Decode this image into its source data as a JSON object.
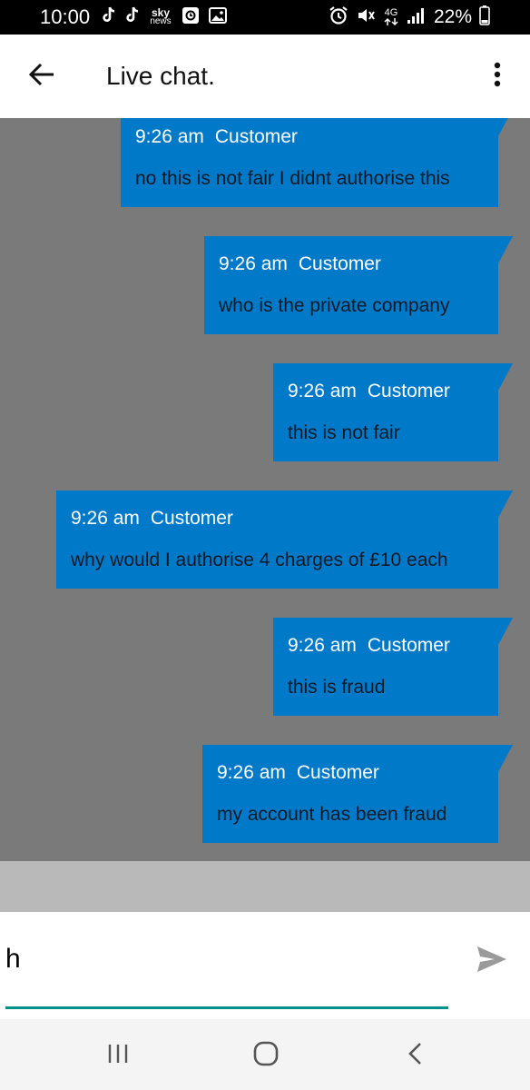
{
  "status_bar": {
    "time": "10:00",
    "news_badge_top": "sky",
    "news_badge_bottom": "news",
    "network_label": "4G",
    "battery": "22%",
    "icons": [
      "tiktok-icon",
      "tiktok-icon",
      "sky-news-icon",
      "app-icon",
      "gallery-icon",
      "alarm-icon",
      "mute-icon",
      "network-4g-icon",
      "signal-icon",
      "battery-icon"
    ]
  },
  "app_bar": {
    "title": "Live chat.",
    "icons": [
      "back-arrow-icon",
      "more-vert-icon"
    ]
  },
  "messages": [
    {
      "time": "9:26 am",
      "sender": "Customer",
      "text": "no this is not fair I didnt authorise this"
    },
    {
      "time": "9:26 am",
      "sender": "Customer",
      "text": "who is the private company"
    },
    {
      "time": "9:26 am",
      "sender": "Customer",
      "text": "this is not fair"
    },
    {
      "time": "9:26 am",
      "sender": "Customer",
      "text": "why would I authorise 4 charges of £10 each"
    },
    {
      "time": "9:26 am",
      "sender": "Customer",
      "text": "this is fraud"
    },
    {
      "time": "9:26 am",
      "sender": "Customer",
      "text": "my account has been fraud"
    }
  ],
  "input": {
    "value": "h",
    "send_icon": "send-icon"
  },
  "nav_bar": {
    "icons": [
      "recent-apps-icon",
      "home-icon",
      "back-icon"
    ]
  },
  "colors": {
    "bubble": "#0079c8",
    "chat_background": "#7a7a7a",
    "accent": "#00908a",
    "strip": "#b9b9b9"
  }
}
